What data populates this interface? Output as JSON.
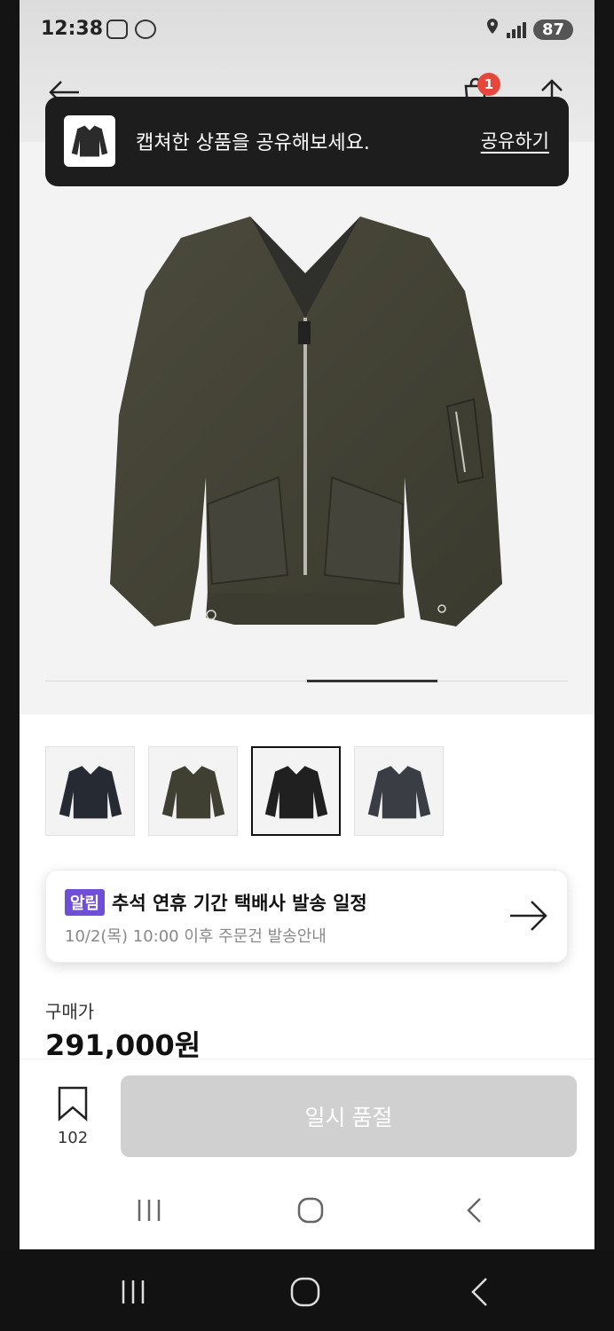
{
  "status": {
    "time": "12:38",
    "battery": "87"
  },
  "toast": {
    "message": "캡쳐한 상품을 공유해보세요.",
    "action": "공유하기"
  },
  "header": {
    "cart_count": "1"
  },
  "gallery": {
    "thumbnail_count": 4,
    "selected_index": 2,
    "page_indicator": "3 of 4"
  },
  "notice": {
    "badge": "알림",
    "title": "추석 연휴 기간 택배사 발송 일정",
    "subtitle": "10/2(목) 10:00 이후 주문건 발송안내"
  },
  "price": {
    "label": "구매가",
    "value": "291,000원"
  },
  "bottom": {
    "wish_count": "102",
    "cta_label": "일시 품절"
  },
  "colors": {
    "accent": "#6f4fd6",
    "badge_red": "#e5483a",
    "toast_bg": "#1d1d1d",
    "disabled_button": "#d0d0d0"
  }
}
